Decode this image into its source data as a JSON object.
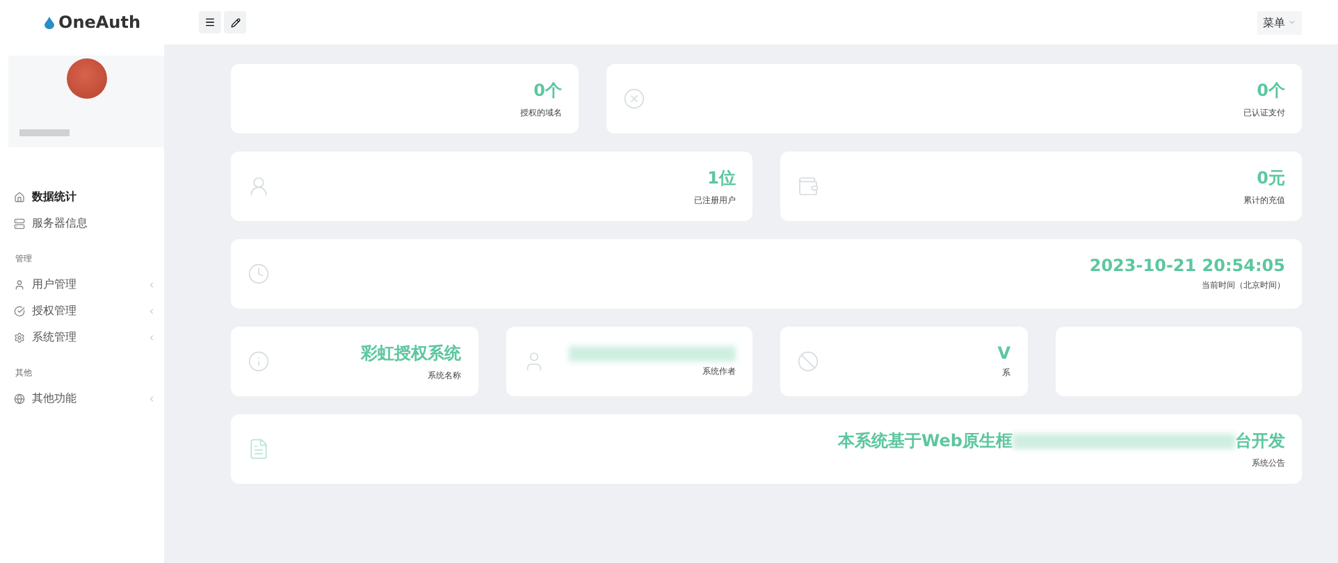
{
  "brand": "OneAuth",
  "header": {
    "menu_label": "菜单"
  },
  "sidebar": {
    "sections": [
      {
        "items": [
          {
            "label": "数据统计",
            "kind": "link",
            "selected": true
          },
          {
            "label": "服务器信息",
            "kind": "link",
            "selected": false
          }
        ]
      },
      {
        "title": "管理",
        "items": [
          {
            "label": "用户管理",
            "kind": "group",
            "selected": false
          },
          {
            "label": "授权管理",
            "kind": "group",
            "selected": false
          },
          {
            "label": "系统管理",
            "kind": "group",
            "selected": false
          }
        ]
      },
      {
        "title": "其他",
        "items": [
          {
            "label": "其他功能",
            "kind": "group",
            "selected": false
          }
        ]
      }
    ]
  },
  "rows": [
    {
      "cards": [
        {
          "kind": "plain",
          "value": "0个",
          "label": "授权的域名"
        },
        {
          "kind": "plain",
          "value": "0个",
          "label": "已认证支付"
        }
      ]
    },
    {
      "cards": [
        {
          "kind": "plain",
          "value": "1位",
          "label": "已注册用户"
        },
        {
          "kind": "plain",
          "value": "0元",
          "label": "累计的充值"
        }
      ]
    },
    {
      "cards": [
        {
          "kind": "plain",
          "value": "2023-10-21 20:54:05",
          "label": "当前时间（北京时间）"
        }
      ]
    },
    {
      "cards": [
        {
          "kind": "plain",
          "value": "彩虹授权系统",
          "label": "系统名称"
        },
        {
          "kind": "blurred",
          "label": "系统作者"
        },
        {
          "kind": "plain",
          "value": "V",
          "label": "系"
        },
        {
          "kind": "empty"
        }
      ]
    },
    {
      "cards": [
        {
          "kind": "blurred",
          "value": "本系统基于Web原生框",
          "value_end": "台开发",
          "label": "系统公告"
        }
      ]
    }
  ]
}
